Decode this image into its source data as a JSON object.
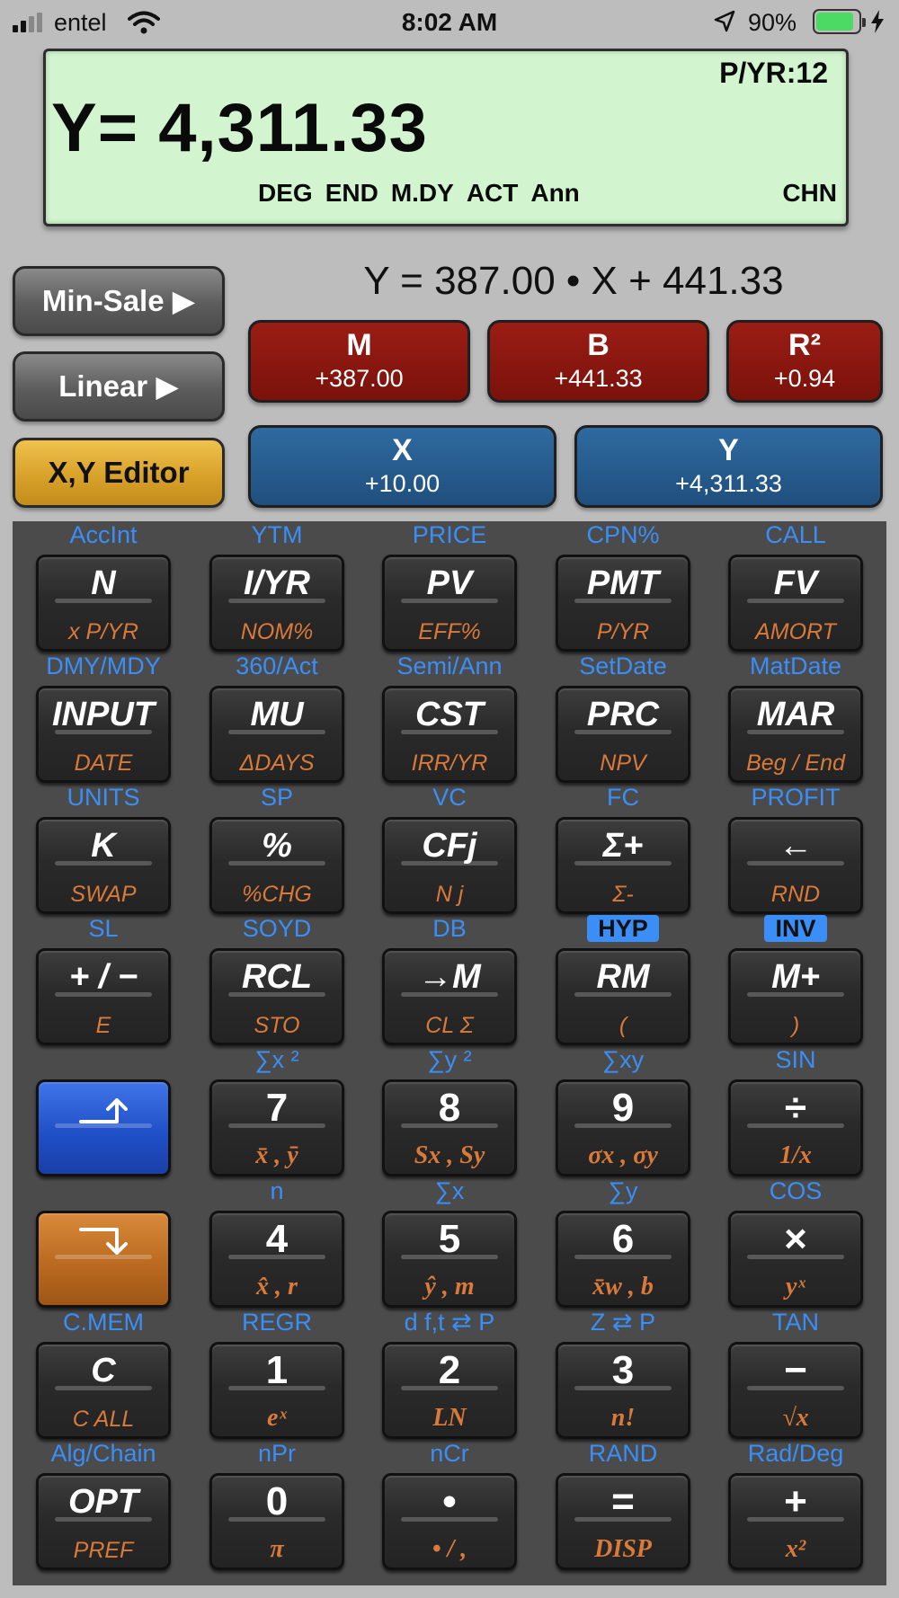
{
  "status": {
    "carrier": "entel",
    "time": "8:02 AM",
    "battery": "90%",
    "battery_level": 0.9
  },
  "lcd": {
    "pyr": "P/YR:12",
    "main": "Y= 4,311.33",
    "flags": [
      "DEG",
      "END",
      "M.DY",
      "ACT",
      "Ann"
    ],
    "chn": "CHN"
  },
  "modes": {
    "min_sale": "Min-Sale ▶",
    "linear": "Linear ▶",
    "xy_editor": "X,Y Editor"
  },
  "equation": "Y = 387.00 • X + 441.33",
  "regression": {
    "m": {
      "label": "M",
      "value": "+387.00"
    },
    "b": {
      "label": "B",
      "value": "+441.33"
    },
    "r2": {
      "label": "R²",
      "value": "+0.94"
    },
    "x": {
      "label": "X",
      "value": "+10.00"
    },
    "y": {
      "label": "Y",
      "value": "+4,311.33"
    }
  },
  "keys": [
    [
      {
        "name": "n",
        "blue": "AccInt",
        "main": "N",
        "sub": "x P/YR"
      },
      {
        "name": "i-yr",
        "blue": "YTM",
        "main": "I/YR",
        "sub": "NOM%"
      },
      {
        "name": "pv",
        "blue": "PRICE",
        "main": "PV",
        "sub": "EFF%"
      },
      {
        "name": "pmt",
        "blue": "CPN%",
        "main": "PMT",
        "sub": "P/YR"
      },
      {
        "name": "fv",
        "blue": "CALL",
        "main": "FV",
        "sub": "AMORT"
      }
    ],
    [
      {
        "name": "input",
        "blue": "DMY/MDY",
        "main": "INPUT",
        "sub": "DATE"
      },
      {
        "name": "mu",
        "blue": "360/Act",
        "main": "MU",
        "sub": "ΔDAYS"
      },
      {
        "name": "cst",
        "blue": "Semi/Ann",
        "main": "CST",
        "sub": "IRR/YR"
      },
      {
        "name": "prc",
        "blue": "SetDate",
        "main": "PRC",
        "sub": "NPV"
      },
      {
        "name": "mar",
        "blue": "MatDate",
        "main": "MAR",
        "sub": "Beg / End"
      }
    ],
    [
      {
        "name": "k",
        "blue": "UNITS",
        "main": "K",
        "sub": "SWAP"
      },
      {
        "name": "percent",
        "blue": "SP",
        "main": "%",
        "sub": "%CHG"
      },
      {
        "name": "cfj",
        "blue": "VC",
        "main": "CFj",
        "sub": "N j"
      },
      {
        "name": "sigma-plus",
        "blue": "FC",
        "main": "Σ+",
        "sub": "Σ-"
      },
      {
        "name": "backspace",
        "blue": "PROFIT",
        "main": "←",
        "sub": "RND"
      }
    ],
    [
      {
        "name": "plus-minus",
        "blue": "SL",
        "main": "+ / −",
        "sub": "E"
      },
      {
        "name": "rcl",
        "blue": "SOYD",
        "main": "RCL",
        "sub": "STO"
      },
      {
        "name": "to-m",
        "blue": "DB",
        "main": "→M",
        "sub": "CL Σ"
      },
      {
        "name": "rm",
        "blue": "HYP",
        "badge": true,
        "main": "RM",
        "sub": "("
      },
      {
        "name": "m-plus",
        "blue": "INV",
        "badge": true,
        "main": "M+",
        "sub": ")"
      }
    ],
    [
      {
        "name": "shift-up",
        "blue": "",
        "main": "",
        "sub": "",
        "style": "shift-blue",
        "icon": "up"
      },
      {
        "name": "7",
        "blue": "∑x ²",
        "main": "7",
        "sub": "x̄ , ȳ",
        "num": true
      },
      {
        "name": "8",
        "blue": "∑y ²",
        "main": "8",
        "sub": "Sx , Sy",
        "num": true
      },
      {
        "name": "9",
        "blue": "∑xy",
        "main": "9",
        "sub": "σx , σy",
        "num": true
      },
      {
        "name": "divide",
        "blue": "SIN",
        "main": "÷",
        "sub": "1/x",
        "num": true
      }
    ],
    [
      {
        "name": "shift-down",
        "blue": "",
        "main": "",
        "sub": "",
        "style": "shift-orange",
        "icon": "down"
      },
      {
        "name": "4",
        "blue": "n",
        "main": "4",
        "sub": "x̂ , r",
        "num": true
      },
      {
        "name": "5",
        "blue": "∑x",
        "main": "5",
        "sub": "ŷ , m",
        "num": true
      },
      {
        "name": "6",
        "blue": "∑y",
        "main": "6",
        "sub": "x̄w , b",
        "num": true
      },
      {
        "name": "multiply",
        "blue": "COS",
        "main": "×",
        "sub": "yˣ",
        "num": true
      }
    ],
    [
      {
        "name": "c",
        "blue": "C.MEM",
        "main": "C",
        "sub": "C ALL"
      },
      {
        "name": "1",
        "blue": "REGR",
        "main": "1",
        "sub": "eˣ",
        "num": true
      },
      {
        "name": "2",
        "blue": "d f,t ⇄ P",
        "main": "2",
        "sub": "LN",
        "num": true
      },
      {
        "name": "3",
        "blue": "Z ⇄ P",
        "main": "3",
        "sub": "n!",
        "num": true
      },
      {
        "name": "minus",
        "blue": "TAN",
        "main": "−",
        "sub": "√x",
        "num": true
      }
    ],
    [
      {
        "name": "opt",
        "blue": "Alg/Chain",
        "main": "OPT",
        "sub": "PREF"
      },
      {
        "name": "0",
        "blue": "nPr",
        "main": "0",
        "sub": "π",
        "num": true
      },
      {
        "name": "decimal",
        "blue": "nCr",
        "main": "•",
        "sub": "• / ,",
        "num": true
      },
      {
        "name": "equals",
        "blue": "RAND",
        "main": "=",
        "sub": "DISP",
        "num": true
      },
      {
        "name": "plus",
        "blue": "Rad/Deg",
        "main": "+",
        "sub": "x²",
        "num": true
      }
    ]
  ]
}
